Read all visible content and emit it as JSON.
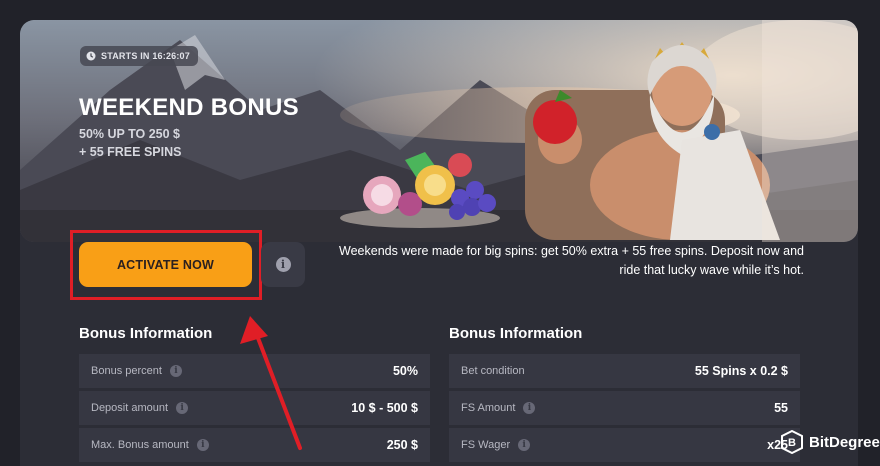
{
  "promo": {
    "timer": "STARTS IN 16:26:07",
    "title": "WEEKEND BONUS",
    "subtitle_line1": "50% UP TO 250 $",
    "subtitle_line2": "+ 55 FREE SPINS"
  },
  "actions": {
    "activate_label": "ACTIVATE NOW",
    "info_symbol": "i"
  },
  "description": "Weekends were made for big spins: get 50% extra + 55 free spins. Deposit now and ride that lucky wave while it’s hot.",
  "bonus_left": {
    "title": "Bonus Information",
    "rows": [
      {
        "label": "Bonus percent",
        "value": "50%"
      },
      {
        "label": "Deposit amount",
        "value": "10 $  -  500 $"
      },
      {
        "label": "Max. Bonus amount",
        "value": "250 $"
      }
    ]
  },
  "bonus_right": {
    "title": "Bonus Information",
    "rows": [
      {
        "label": "Bet condition",
        "value": "55 Spins x  0.2 $"
      },
      {
        "label": "FS Amount",
        "value": "55"
      },
      {
        "label": "FS Wager",
        "value": "x25"
      }
    ]
  },
  "watermark": "BitDegree",
  "colors": {
    "page_bg": "#212229",
    "card_bg": "#2c2d36",
    "row_bg": "#363742",
    "accent": "#f99f16",
    "highlight": "#e01e26"
  },
  "icons": [
    "clock-icon",
    "info-icon",
    "help-circle-icon",
    "bitdegree-logo"
  ]
}
